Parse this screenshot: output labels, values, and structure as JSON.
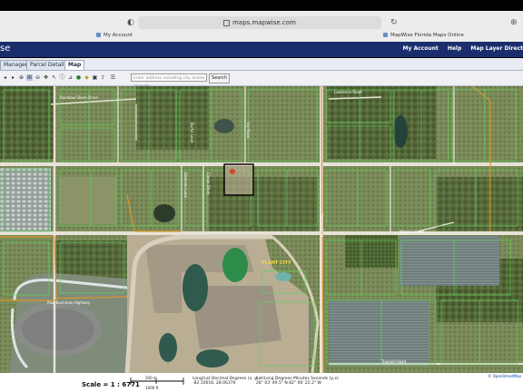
{
  "browser": {
    "url": "maps.mapwise.com",
    "tabs": [
      {
        "label": "My Account"
      },
      {
        "label": "MapWise Florida Maps Online"
      }
    ]
  },
  "header": {
    "logo_text": "se",
    "nav": [
      "My Account",
      "Help",
      "Map Layer Direct"
    ]
  },
  "app_tabs": [
    {
      "label": "Manager",
      "active": false
    },
    {
      "label": "Parcel Details",
      "active": false
    },
    {
      "label": "Map",
      "active": true
    }
  ],
  "toolbar": {
    "icons": [
      "arrow-left-icon",
      "arrow-right-icon",
      "zoom-in-icon",
      "zoom-out-icon",
      "zoom-box-icon",
      "pan-icon",
      "select-icon",
      "identify-icon",
      "measure-icon",
      "buffer-icon",
      "layers-icon",
      "print-icon",
      "export-icon",
      "info-icon"
    ],
    "address_placeholder": "Enter address including city and/or zipcode",
    "search_label": "Search"
  },
  "map": {
    "place_label": "PLANT CITY",
    "road_labels": [
      "Lawrence Road",
      "Wiggins Road",
      "Ulysses Road",
      "Paul Buchman Highway",
      "Trapnell Road",
      "Rainbow Shore Drive",
      "Dedmon Lane",
      "Cason Drive",
      "Ivy Road",
      "Burke Lane"
    ],
    "attribution": "© OpenStreetMap"
  },
  "footer": {
    "scale": "Scale = 1 : 6771",
    "scale_bar_labels": [
      "200 m",
      "1000 ft"
    ],
    "coord_label_1": "Long/Lat Decimal Degrees (x, y)",
    "coord_value_1": "-82.10616, 28.06376",
    "coord_label_2": "Lat/Long Degrees Minutes Seconds (y,x)",
    "coord_value_2": "28° 03' 49.5\" N 82° 06' 22.2\" W"
  },
  "colors": {
    "header_bg": "#1a2e6e",
    "parcel_line": "#5fd35f",
    "boundary_line": "#e0962c",
    "selected_parcel": "#000000"
  }
}
